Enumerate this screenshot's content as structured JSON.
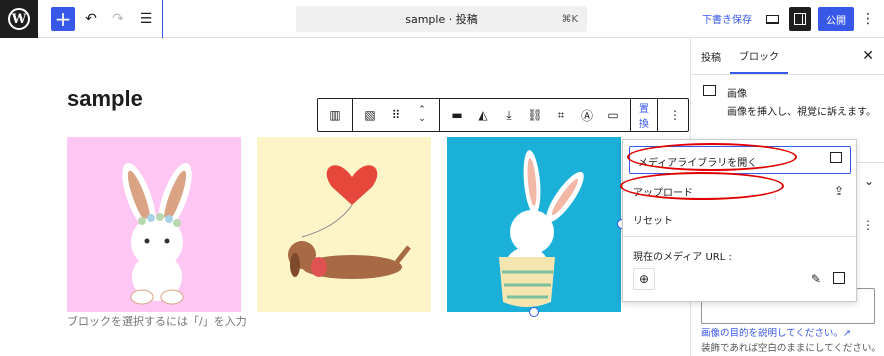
{
  "topbar": {
    "logo": "W",
    "command": "sample · 投稿",
    "command_shortcut": "⌘K",
    "save_draft": "下書き保存",
    "publish": "公開"
  },
  "editor": {
    "title": "sample",
    "caption_placeholder": "ブロックを選択するには「/」を入力"
  },
  "toolbar": {
    "replace": "置換"
  },
  "replace_menu": {
    "open_library": "メディアライブラリを開く",
    "upload": "アップロード",
    "reset": "リセット",
    "current_url_label": "現在のメディア URL :"
  },
  "sidebar": {
    "tabs": [
      "投稿",
      "ブロック"
    ],
    "block_name": "画像",
    "block_desc": "画像を挿入し、視覚に訴えます。",
    "alt_link": "画像の目的を説明してください。↗",
    "alt_help": "装飾であれば空白のままにしてください。"
  },
  "colors": {
    "accent": "#3858e9",
    "annotation": "#e00000",
    "img1_bg": "#fdc6f3",
    "img2_bg": "#fdf5c8",
    "img3_bg": "#1bb0d8"
  }
}
